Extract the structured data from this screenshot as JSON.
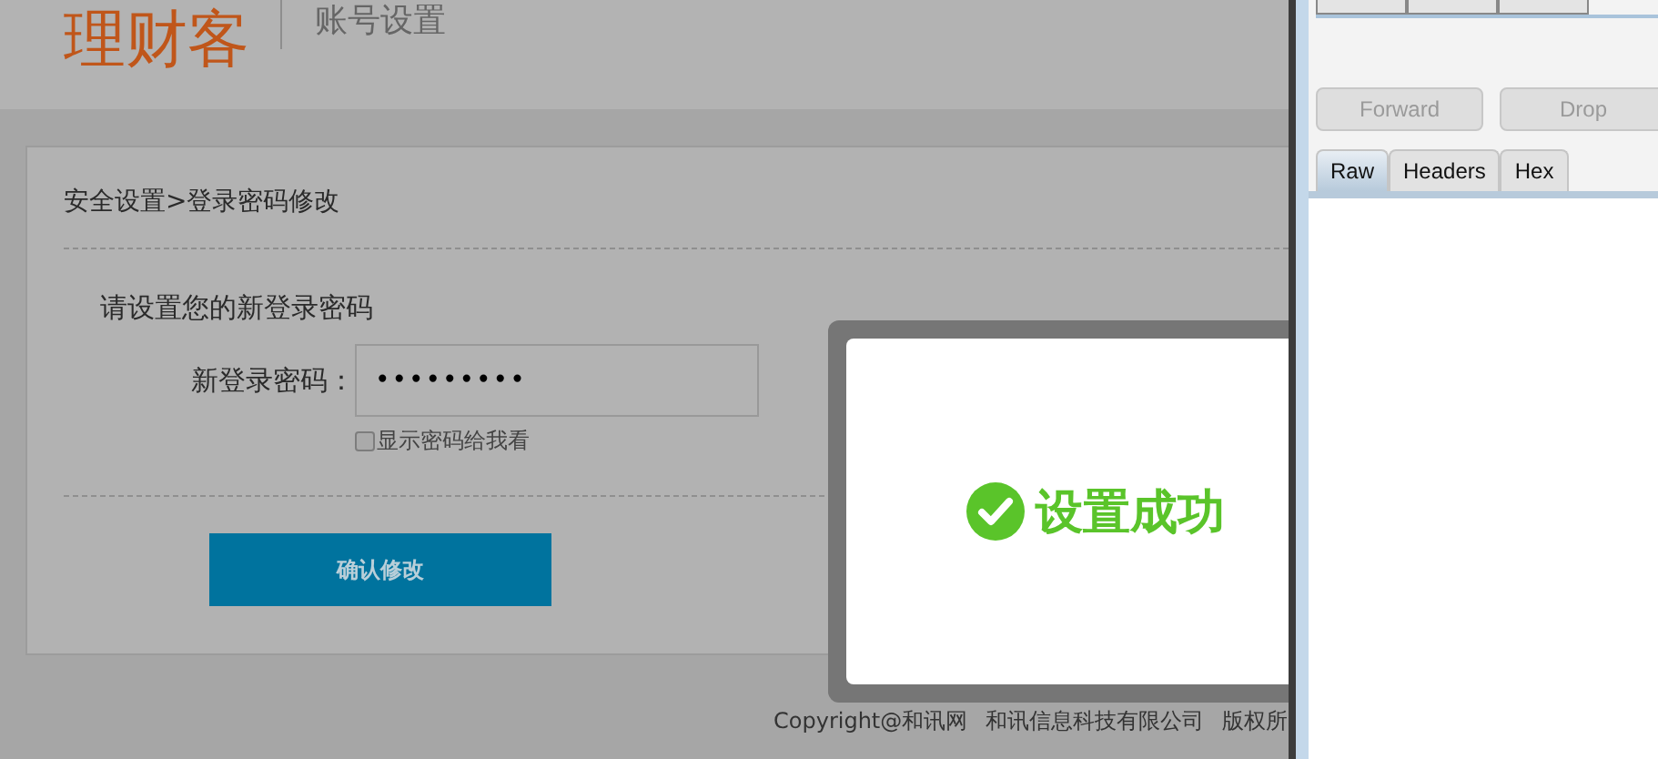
{
  "header": {
    "logo": "理财客",
    "section": "账号设置"
  },
  "breadcrumb": "安全设置>登录密码修改",
  "form": {
    "heading": "请设置您的新登录密码",
    "label": "新登录密码：",
    "value": "•••••••••",
    "show_password": {
      "label": "显示密码给我看",
      "checked": false
    },
    "submit": "确认修改"
  },
  "footer": [
    "Copyright@和讯网",
    "和讯信息科技有限公司",
    "版权所"
  ],
  "dialog": {
    "message": "设置成功"
  },
  "proxy_panel": {
    "buttons": [
      {
        "label": "Forward",
        "disabled": true
      },
      {
        "label": "Drop",
        "disabled": true
      }
    ],
    "tabs": [
      {
        "label": "Raw",
        "selected": true
      },
      {
        "label": "Headers",
        "selected": false
      },
      {
        "label": "Hex",
        "selected": false
      }
    ]
  }
}
